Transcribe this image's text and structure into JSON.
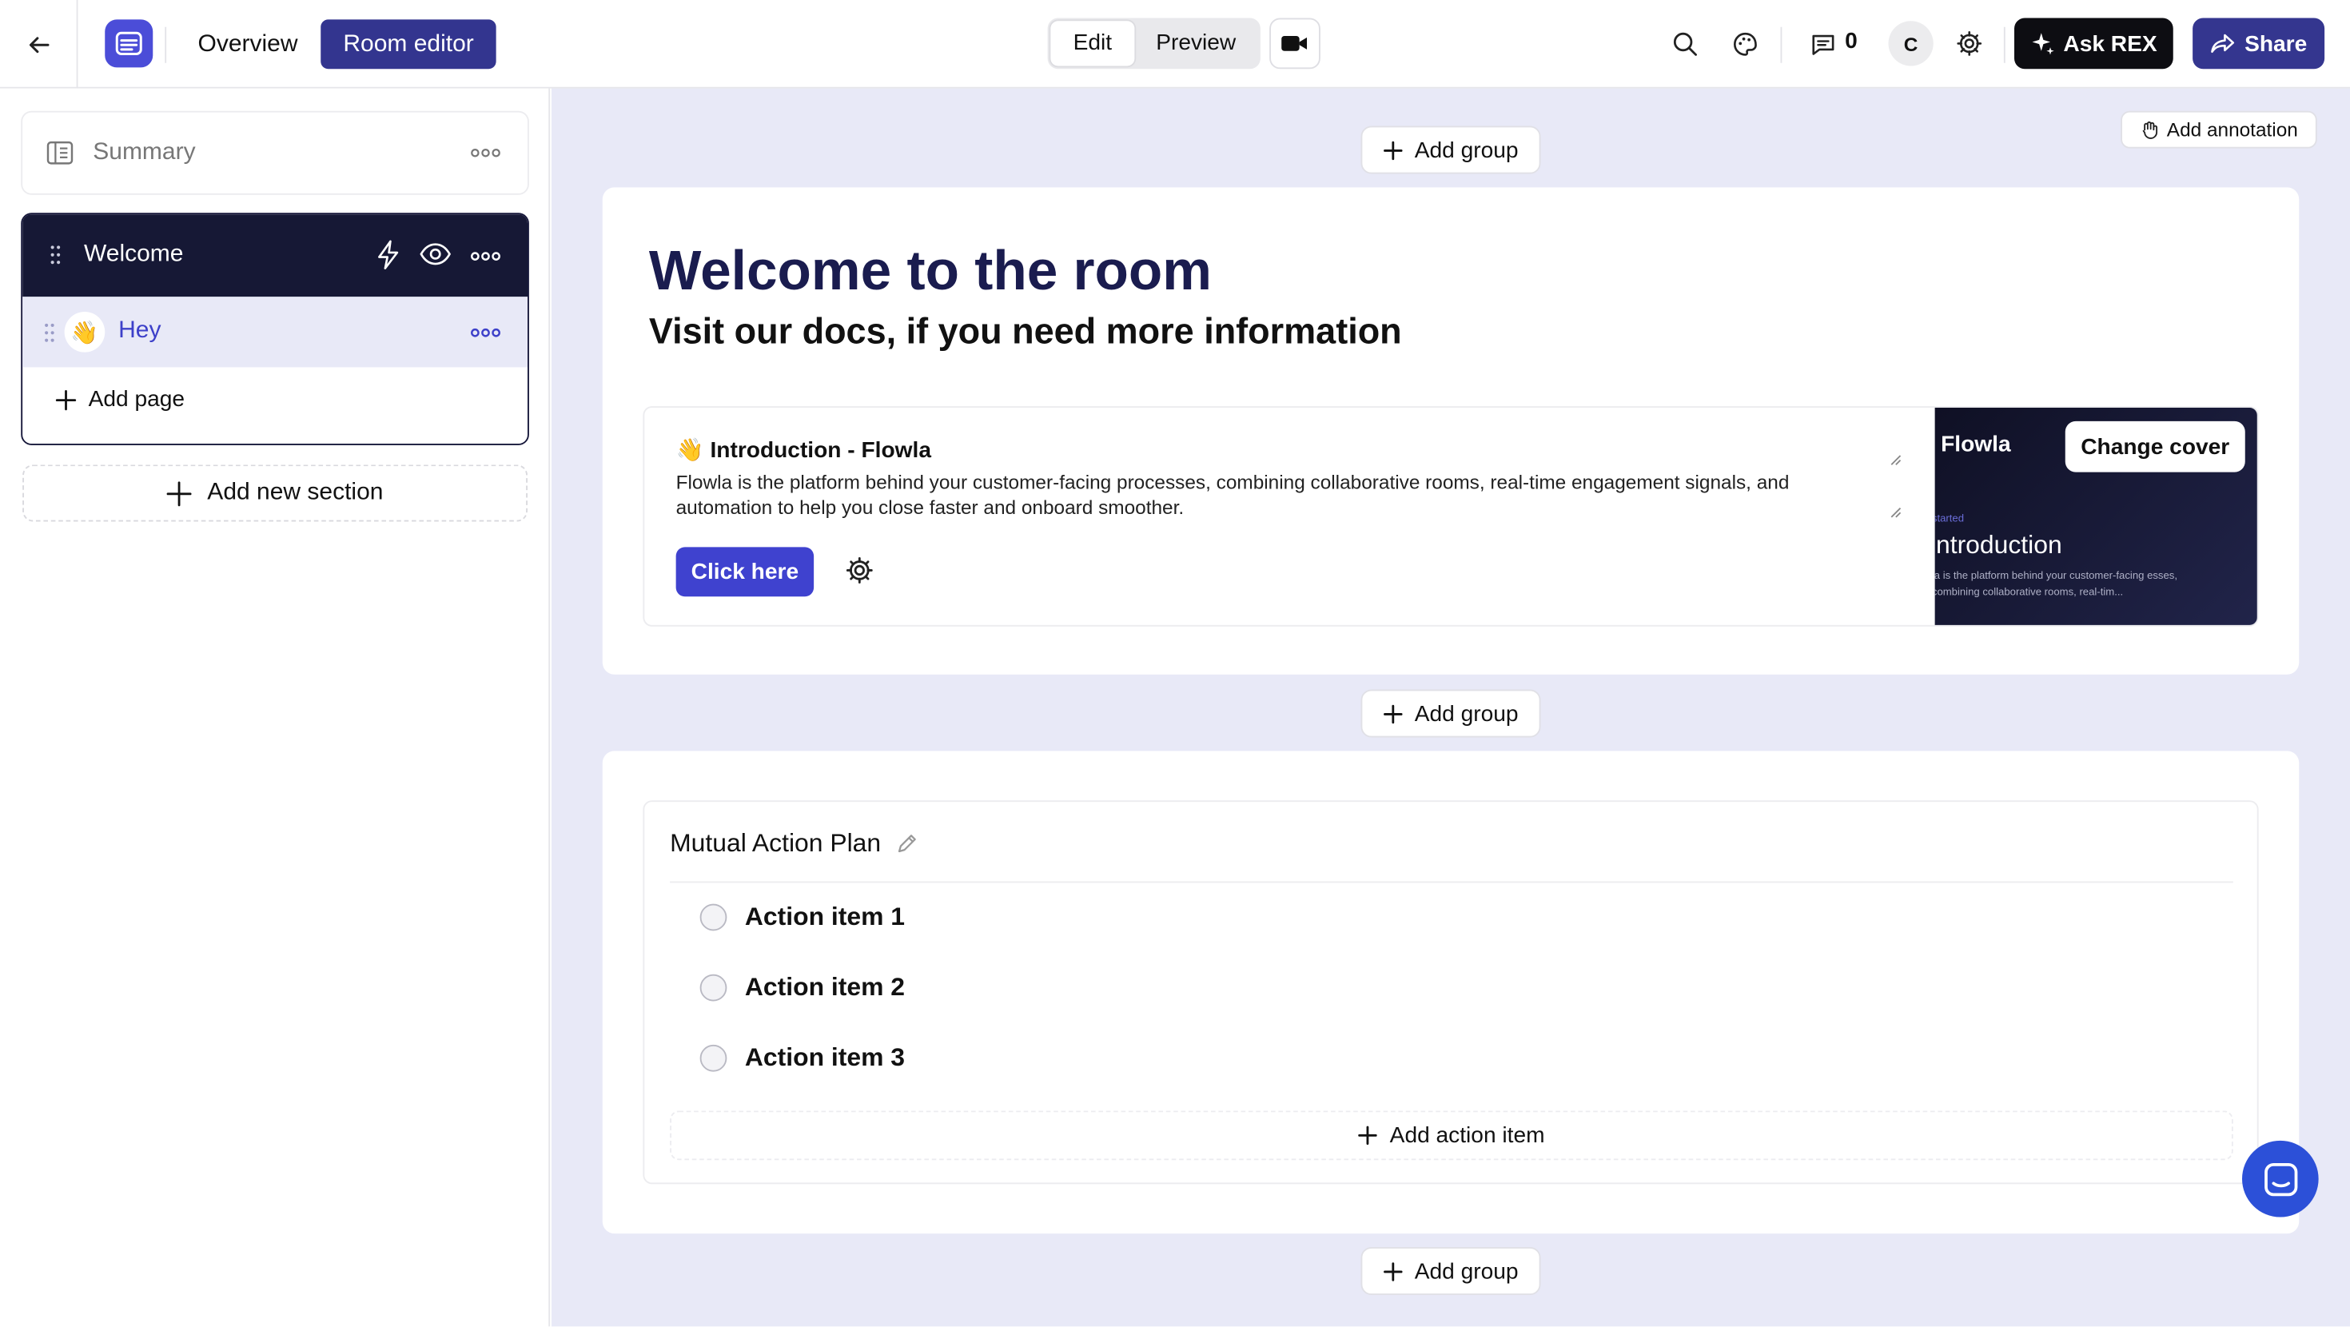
{
  "topbar": {
    "nav": {
      "overview": "Overview",
      "room_editor": "Room editor"
    },
    "mode": {
      "edit": "Edit",
      "preview": "Preview"
    },
    "comments_count": "0",
    "avatar_initial": "C",
    "ask_rex": "Ask REX",
    "share": "Share"
  },
  "sidebar": {
    "summary_label": "Summary",
    "section": {
      "title": "Welcome",
      "pages": [
        {
          "emoji": "👋",
          "label": "Hey"
        }
      ]
    },
    "add_page": "Add page",
    "add_new_section": "Add new section"
  },
  "main": {
    "add_group": "Add group",
    "add_annotation": "Add annotation",
    "heading": "Welcome to the room",
    "subheading": "Visit our docs, if you need more information",
    "intro_block": {
      "title": "👋 Introduction - Flowla",
      "description": "Flowla is the platform behind your customer-facing processes, combining collaborative rooms, real-time engagement signals, and automation to help you close faster and onboard smoother.",
      "button_label": "Click here",
      "cover": {
        "brand": "Flowla",
        "change_cover": "Change cover",
        "tag": "started",
        "title": "Introduction",
        "description": "la is the platform behind your customer-facing esses, combining collaborative rooms, real-tim..."
      }
    },
    "action_plan": {
      "title": "Mutual Action Plan",
      "items": [
        "Action item 1",
        "Action item 2",
        "Action item 3"
      ],
      "add_item": "Add action item"
    }
  },
  "colors": {
    "primary": "#33358f",
    "accent": "#3f42cf",
    "section_header": "#161835",
    "canvas": "#e8e9f7",
    "heading": "#1a1c4f"
  },
  "icons": [
    "back-arrow-icon",
    "logo-icon",
    "video-camera-icon",
    "search-icon",
    "palette-icon",
    "comment-icon",
    "settings-gear-icon",
    "sparkle-icon",
    "share-arrow-icon",
    "summary-doc-icon",
    "drag-handle-icon",
    "lightning-icon",
    "eye-icon",
    "more-dots-icon",
    "plus-icon",
    "wave-hand-icon",
    "pencil-icon",
    "chat-icon"
  ]
}
